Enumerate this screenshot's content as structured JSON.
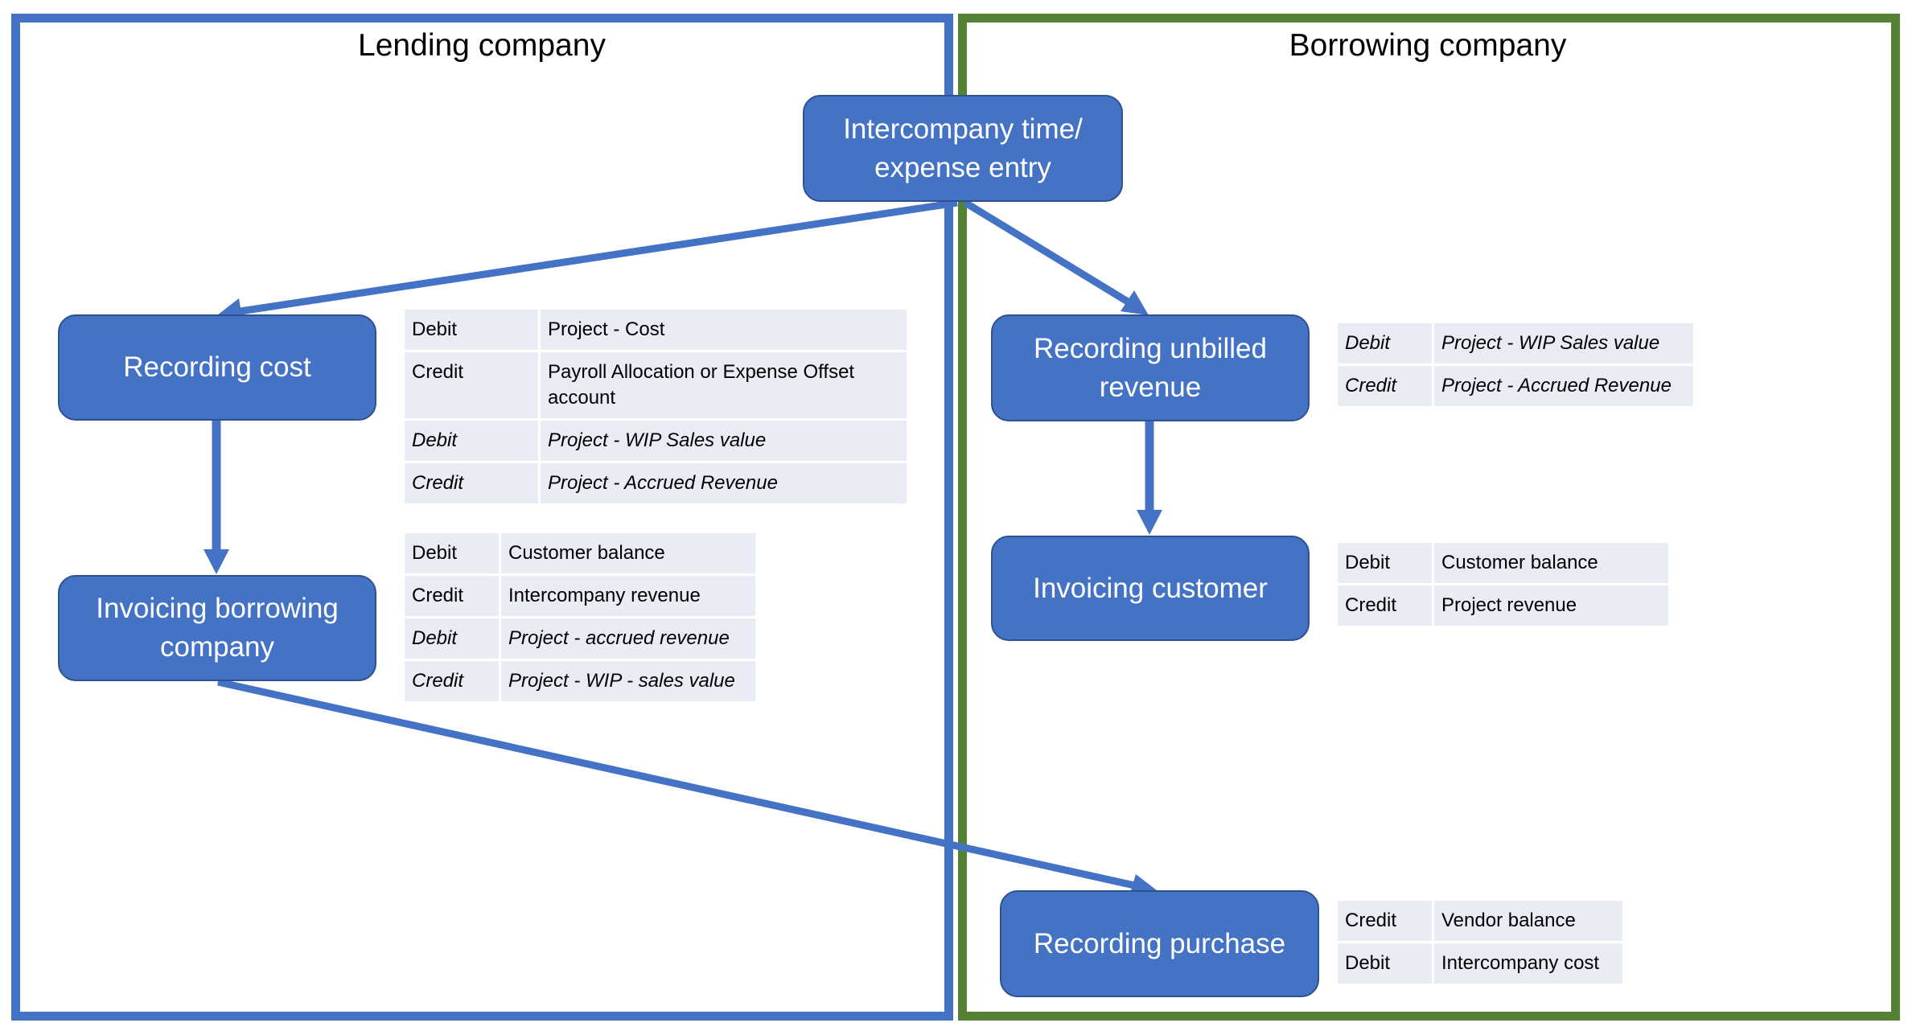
{
  "regions": {
    "lending": {
      "title": "Lending company",
      "color": "#4472C4"
    },
    "borrowing": {
      "title": "Borrowing company",
      "color": "#548235"
    }
  },
  "nodes": {
    "intercompany_entry": {
      "line1": "Intercompany time/",
      "line2": "expense entry"
    },
    "recording_cost": {
      "line1": "Recording cost"
    },
    "invoicing_borrowing": {
      "line1": "Invoicing borrowing",
      "line2": "company"
    },
    "recording_unbilled": {
      "line1": "Recording unbilled",
      "line2": "revenue"
    },
    "invoicing_customer": {
      "line1": "Invoicing customer"
    },
    "recording_purchase": {
      "line1": "Recording purchase"
    }
  },
  "tables": {
    "recording_cost": [
      {
        "type": "Debit",
        "account": "Project - Cost",
        "italic": false
      },
      {
        "type": "Credit",
        "account": "Payroll Allocation or Expense Offset account",
        "italic": false
      },
      {
        "type": "Debit",
        "account": "Project - WIP Sales value",
        "italic": true
      },
      {
        "type": "Credit",
        "account": "Project - Accrued Revenue",
        "italic": true
      }
    ],
    "invoicing_borrowing": [
      {
        "type": "Debit",
        "account": "Customer balance",
        "italic": false
      },
      {
        "type": "Credit",
        "account": "Intercompany revenue",
        "italic": false
      },
      {
        "type": "Debit",
        "account": "Project - accrued revenue",
        "italic": true
      },
      {
        "type": "Credit",
        "account": "Project - WIP - sales value",
        "italic": true
      }
    ],
    "recording_unbilled": [
      {
        "type": "Debit",
        "account": "Project - WIP Sales value",
        "italic": true
      },
      {
        "type": "Credit",
        "account": "Project - Accrued Revenue",
        "italic": true
      }
    ],
    "invoicing_customer": [
      {
        "type": "Debit",
        "account": "Customer balance",
        "italic": false
      },
      {
        "type": "Credit",
        "account": "Project revenue",
        "italic": false
      }
    ],
    "recording_purchase": [
      {
        "type": "Credit",
        "account": "Vendor balance",
        "italic": false
      },
      {
        "type": "Debit",
        "account": "Intercompany cost",
        "italic": false
      }
    ]
  },
  "connections": [
    {
      "from": "intercompany_entry",
      "to": "recording_cost"
    },
    {
      "from": "intercompany_entry",
      "to": "recording_unbilled"
    },
    {
      "from": "recording_cost",
      "to": "invoicing_borrowing"
    },
    {
      "from": "recording_unbilled",
      "to": "invoicing_customer"
    },
    {
      "from": "invoicing_borrowing",
      "to": "recording_purchase"
    }
  ],
  "colors": {
    "node_fill": "#4472C4",
    "node_border": "#2F528F",
    "arrow": "#4472C4",
    "table_cell": "#E9EBF5"
  }
}
